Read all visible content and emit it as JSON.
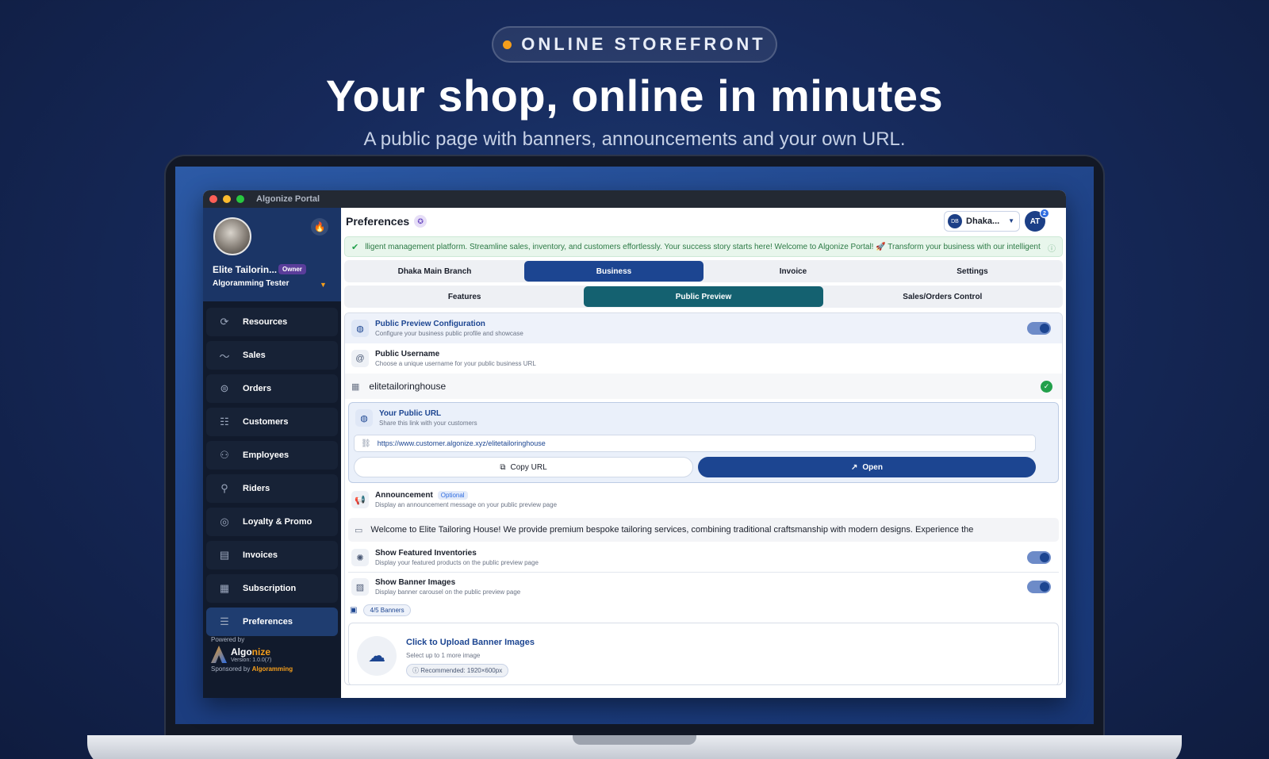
{
  "hero": {
    "pill_label": "ONLINE STOREFRONT",
    "title": "Your shop, online in minutes",
    "subtitle": "A public page with banners, announcements and your own URL.",
    "accent_color": "#f59e1b"
  },
  "window": {
    "title": "Algonize Portal"
  },
  "sidebar": {
    "shop_name": "Elite Tailorin...",
    "role_badge": "Owner",
    "user_name": "Algoramming Tester",
    "items": [
      {
        "label": "Resources",
        "icon": "refresh-icon"
      },
      {
        "label": "Sales",
        "icon": "trend-icon"
      },
      {
        "label": "Orders",
        "icon": "orders-icon"
      },
      {
        "label": "Customers",
        "icon": "customers-icon"
      },
      {
        "label": "Employees",
        "icon": "employees-icon"
      },
      {
        "label": "Riders",
        "icon": "riders-icon"
      },
      {
        "label": "Loyalty & Promo",
        "icon": "medal-icon"
      },
      {
        "label": "Invoices",
        "icon": "invoice-icon"
      },
      {
        "label": "Subscription",
        "icon": "subscription-icon"
      },
      {
        "label": "Preferences",
        "icon": "sliders-icon",
        "active": true
      }
    ],
    "powered_by": "Powered by",
    "brand_a": "Algo",
    "brand_b": "nize",
    "version": "Version: 1.0.0(7)",
    "sponsored_prefix": "Sponsored by ",
    "sponsor": "Algoramming"
  },
  "header": {
    "title": "Preferences",
    "branch_initials": "DB",
    "branch_label": "Dhaka...",
    "user_initials": "AT",
    "notification_count": "2"
  },
  "ticker": {
    "text": "lligent management platform. Streamline sales, inventory, and customers effortlessly. Your success story starts here!  Welcome to Algonize Portal! 🚀  Transform your business with our intelligent"
  },
  "tabs": [
    "Dhaka Main Branch",
    "Business",
    "Invoice",
    "Settings"
  ],
  "subtabs": [
    "Features",
    "Public Preview",
    "Sales/Orders Control"
  ],
  "config": {
    "title": "Public Preview Configuration",
    "desc": "Configure your business public profile and showcase",
    "enabled": true
  },
  "username": {
    "title": "Public Username",
    "desc": "Choose a unique username for your public business URL",
    "value": "elitetailoringhouse"
  },
  "public_url": {
    "title": "Your Public URL",
    "desc": "Share this link with your customers",
    "url": "https://www.customer.algonize.xyz/elitetailoringhouse",
    "copy_label": "Copy URL",
    "open_label": "Open"
  },
  "announcement": {
    "title": "Announcement",
    "badge": "Optional",
    "desc": "Display an announcement message on your public preview page",
    "value": "Welcome to Elite Tailoring House! We provide premium bespoke tailoring services, combining traditional craftsmanship with modern designs. Experience the"
  },
  "featured": {
    "title": "Show Featured Inventories",
    "desc": "Display your featured products on the public preview page",
    "enabled": true
  },
  "banners": {
    "title": "Show Banner Images",
    "desc": "Display banner carousel on the public preview page",
    "enabled": true,
    "count": "4/5 Banners",
    "upload_title": "Click to Upload Banner Images",
    "upload_sub": "Select up to 1 more image",
    "recommended": "Recommended: 1920×600px"
  }
}
